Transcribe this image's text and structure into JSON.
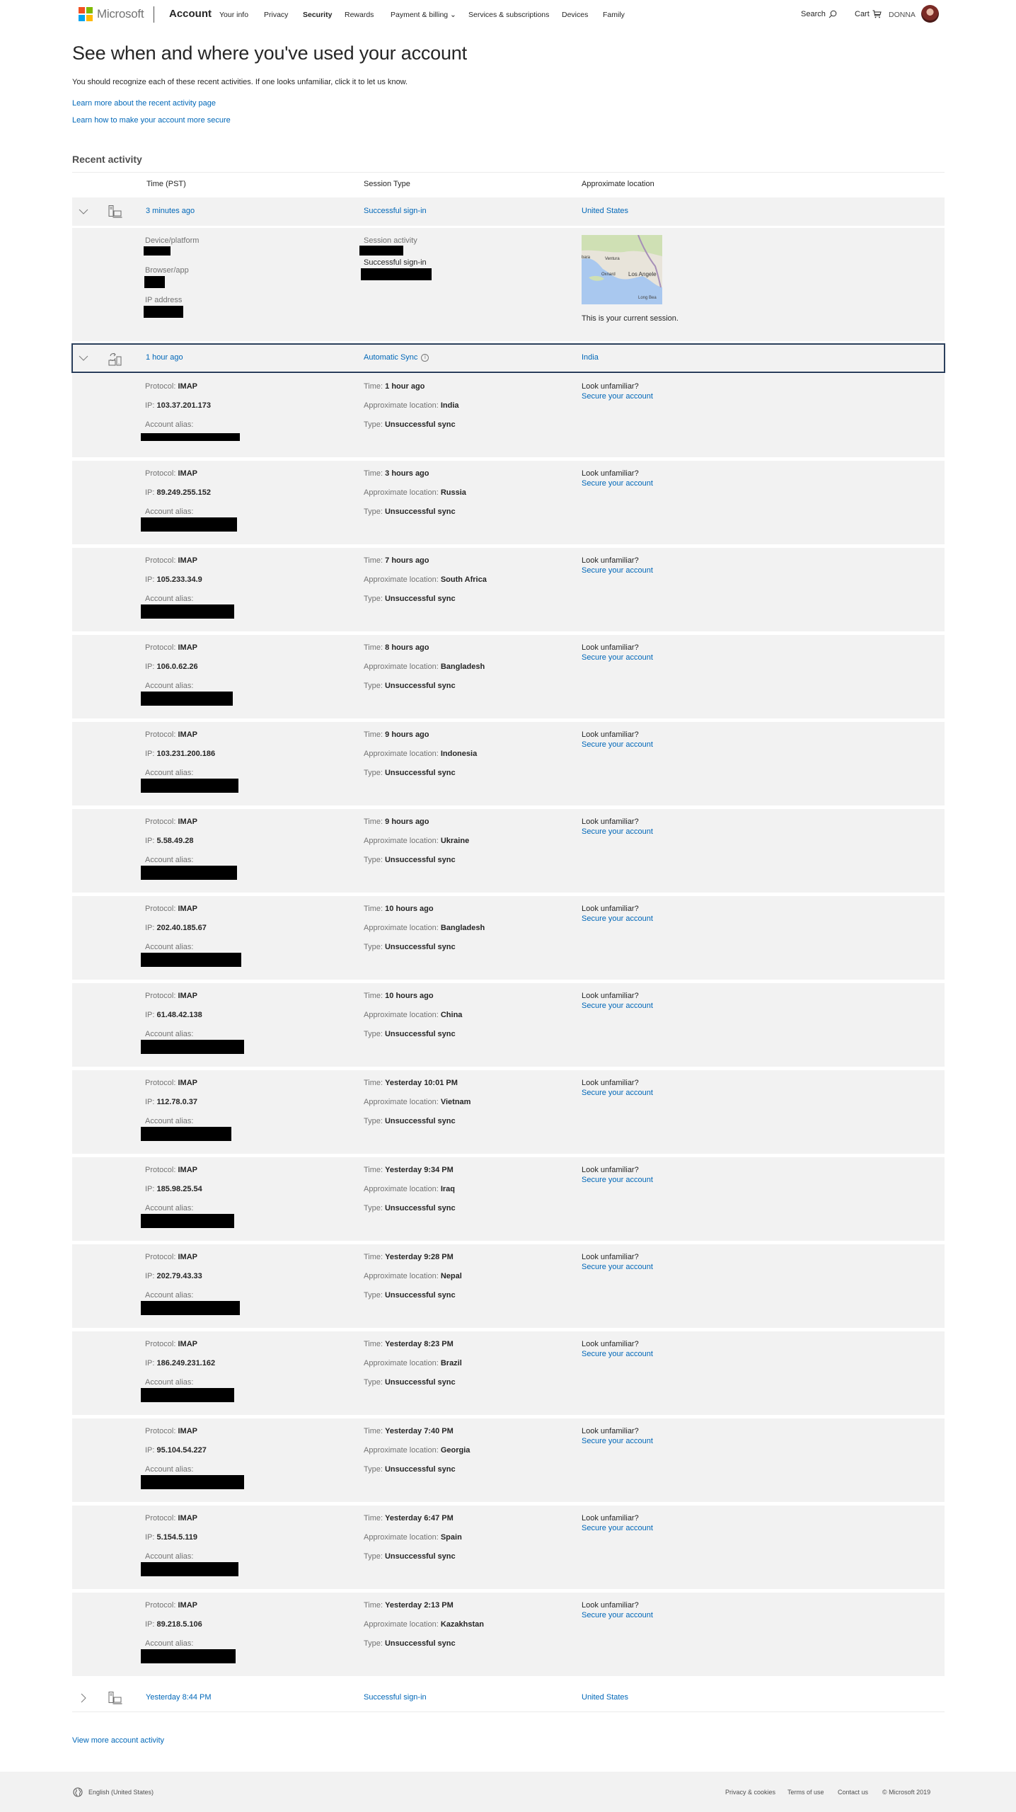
{
  "header": {
    "brand": "Microsoft",
    "product": "Account",
    "nav": [
      {
        "label": "Your info",
        "active": false
      },
      {
        "label": "Privacy",
        "active": false
      },
      {
        "label": "Security",
        "active": true
      },
      {
        "label": "Rewards",
        "active": false
      },
      {
        "label": "Payment & billing ⌄",
        "active": false
      },
      {
        "label": "Services & subscriptions",
        "active": false
      },
      {
        "label": "Devices",
        "active": false
      },
      {
        "label": "Family",
        "active": false
      }
    ],
    "search_label": "Search",
    "cart_label": "Cart",
    "user_name": "DONNA",
    "logo_colors": [
      "#f25022",
      "#7fba00",
      "#00a4ef",
      "#ffb900"
    ]
  },
  "intro": {
    "title": "See when and where you've used your account",
    "text": "You should recognize each of these recent activities. If one looks unfamiliar, click it to let us know.",
    "link1": "Learn more about the recent activity page",
    "link2": "Learn how to make your account more secure"
  },
  "activity": {
    "section_title": "Recent activity",
    "columns": [
      "Time (PST)",
      "Session Type",
      "Approximate location"
    ],
    "sessions": [
      {
        "time": "3 minutes ago",
        "type": "Successful sign-in",
        "location": "United States",
        "expanded": true,
        "icon": "computer-icon"
      },
      {
        "time": "1 hour ago",
        "type": "Automatic Sync",
        "location": "India",
        "expanded": true,
        "icon": "sync-device-icon"
      },
      {
        "time": "Yesterday 8:44 PM",
        "type": "Successful sign-in",
        "location": "United States",
        "expanded": false,
        "icon": "computer-icon"
      }
    ],
    "current_session": {
      "device_label": "Device/platform",
      "browser_label": "Browser/app",
      "ip_label": "IP address",
      "activity_label": "Session activity",
      "activity_value": "Successful sign-in",
      "map_labels": [
        "bara",
        "Ventura",
        "Oxnard",
        "Los Angele",
        "Long Bea"
      ],
      "note": "This is your current session."
    },
    "sync_labels": {
      "protocol": "Protocol: ",
      "ip": "IP: ",
      "alias": "Account alias:",
      "time": "Time: ",
      "location": "Approximate location: ",
      "type": "Type: ",
      "look": "Look unfamiliar?",
      "secure": "Secure your account"
    },
    "sync_events": [
      {
        "protocol": "IMAP",
        "ip": "103.37.201.173",
        "time": "1 hour ago",
        "location": "India",
        "type": "Unsuccessful sync"
      },
      {
        "protocol": "IMAP",
        "ip": "89.249.255.152",
        "time": "3 hours ago",
        "location": "Russia",
        "type": "Unsuccessful sync"
      },
      {
        "protocol": "IMAP",
        "ip": "105.233.34.9",
        "time": "7 hours ago",
        "location": "South Africa",
        "type": "Unsuccessful sync"
      },
      {
        "protocol": "IMAP",
        "ip": "106.0.62.26",
        "time": "8 hours ago",
        "location": "Bangladesh",
        "type": "Unsuccessful sync"
      },
      {
        "protocol": "IMAP",
        "ip": "103.231.200.186",
        "time": "9 hours ago",
        "location": "Indonesia",
        "type": "Unsuccessful sync"
      },
      {
        "protocol": "IMAP",
        "ip": "5.58.49.28",
        "time": "9 hours ago",
        "location": "Ukraine",
        "type": "Unsuccessful sync"
      },
      {
        "protocol": "IMAP",
        "ip": "202.40.185.67",
        "time": "10 hours ago",
        "location": "Bangladesh",
        "type": "Unsuccessful sync"
      },
      {
        "protocol": "IMAP",
        "ip": "61.48.42.138",
        "time": "10 hours ago",
        "location": "China",
        "type": "Unsuccessful sync"
      },
      {
        "protocol": "IMAP",
        "ip": "112.78.0.37",
        "time": "Yesterday 10:01 PM",
        "location": "Vietnam",
        "type": "Unsuccessful sync"
      },
      {
        "protocol": "IMAP",
        "ip": "185.98.25.54",
        "time": "Yesterday 9:34 PM",
        "location": "Iraq",
        "type": "Unsuccessful sync"
      },
      {
        "protocol": "IMAP",
        "ip": "202.79.43.33",
        "time": "Yesterday 9:28 PM",
        "location": "Nepal",
        "type": "Unsuccessful sync"
      },
      {
        "protocol": "IMAP",
        "ip": "186.249.231.162",
        "time": "Yesterday 8:23 PM",
        "location": "Brazil",
        "type": "Unsuccessful sync"
      },
      {
        "protocol": "IMAP",
        "ip": "95.104.54.227",
        "time": "Yesterday 7:40 PM",
        "location": "Georgia",
        "type": "Unsuccessful sync"
      },
      {
        "protocol": "IMAP",
        "ip": "5.154.5.119",
        "time": "Yesterday 6:47 PM",
        "location": "Spain",
        "type": "Unsuccessful sync"
      },
      {
        "protocol": "IMAP",
        "ip": "89.218.5.106",
        "time": "Yesterday 2:13 PM",
        "location": "Kazakhstan",
        "type": "Unsuccessful sync"
      }
    ],
    "view_more": "View more account activity"
  },
  "footer": {
    "language": "English (United States)",
    "links": [
      "Privacy & cookies",
      "Terms of use",
      "Contact us"
    ],
    "copyright": "© Microsoft 2019"
  }
}
